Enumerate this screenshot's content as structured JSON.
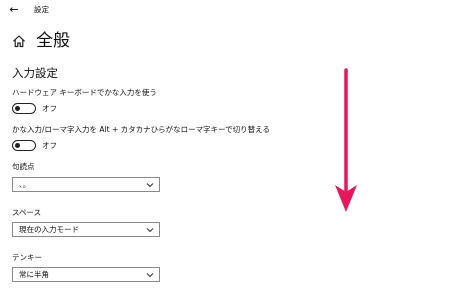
{
  "window": {
    "back_glyph": "←",
    "title": "設定"
  },
  "header": {
    "icon": "home-icon",
    "title": "全般"
  },
  "section": {
    "title": "入力設定"
  },
  "settings": {
    "hardware_keyboard": {
      "label": "ハードウェア キーボードでかな入力を使う",
      "state": "オフ",
      "on": false
    },
    "kana_romaji_toggle": {
      "label": "かな入力/ローマ字入力を Alt + カタカナひらがなローマ字キーで切り替える",
      "state": "オフ",
      "on": false
    },
    "punctuation": {
      "label": "句読点",
      "value": "、。"
    },
    "space": {
      "label": "スペース",
      "value": "現在の入力モード"
    },
    "tenkey": {
      "label": "テンキー",
      "value": "常に半角"
    }
  },
  "colors": {
    "annotation_arrow": "#e8175d",
    "control_border": "#222222"
  }
}
